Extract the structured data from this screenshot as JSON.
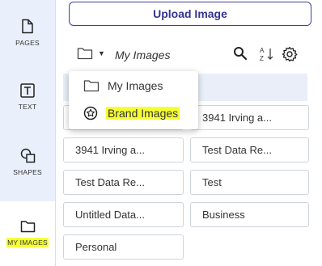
{
  "rail": {
    "items": [
      {
        "label": "PAGES",
        "icon": "page-icon"
      },
      {
        "label": "TEXT",
        "icon": "text-icon"
      },
      {
        "label": "SHAPES",
        "icon": "shapes-icon"
      },
      {
        "label": "MY IMAGES",
        "icon": "folder-icon",
        "active": true
      }
    ]
  },
  "toolbar": {
    "upload_label": "Upload Image",
    "current_folder": "My Images"
  },
  "dropdown": {
    "items": [
      {
        "label": "My Images",
        "icon": "folder-icon"
      },
      {
        "label": "Brand Images",
        "icon": "star-badge-icon",
        "highlighted": true
      }
    ]
  },
  "folders": [
    "3941 Irving a...",
    "3941 Irving a...",
    "Test Data Re...",
    "Test Data Re...",
    "Test",
    "Untitled Data...",
    "Business",
    "Personal"
  ],
  "colors": {
    "accent": "#34348f",
    "rail_bg": "#eaf0fb",
    "highlight": "#f5ff33"
  }
}
